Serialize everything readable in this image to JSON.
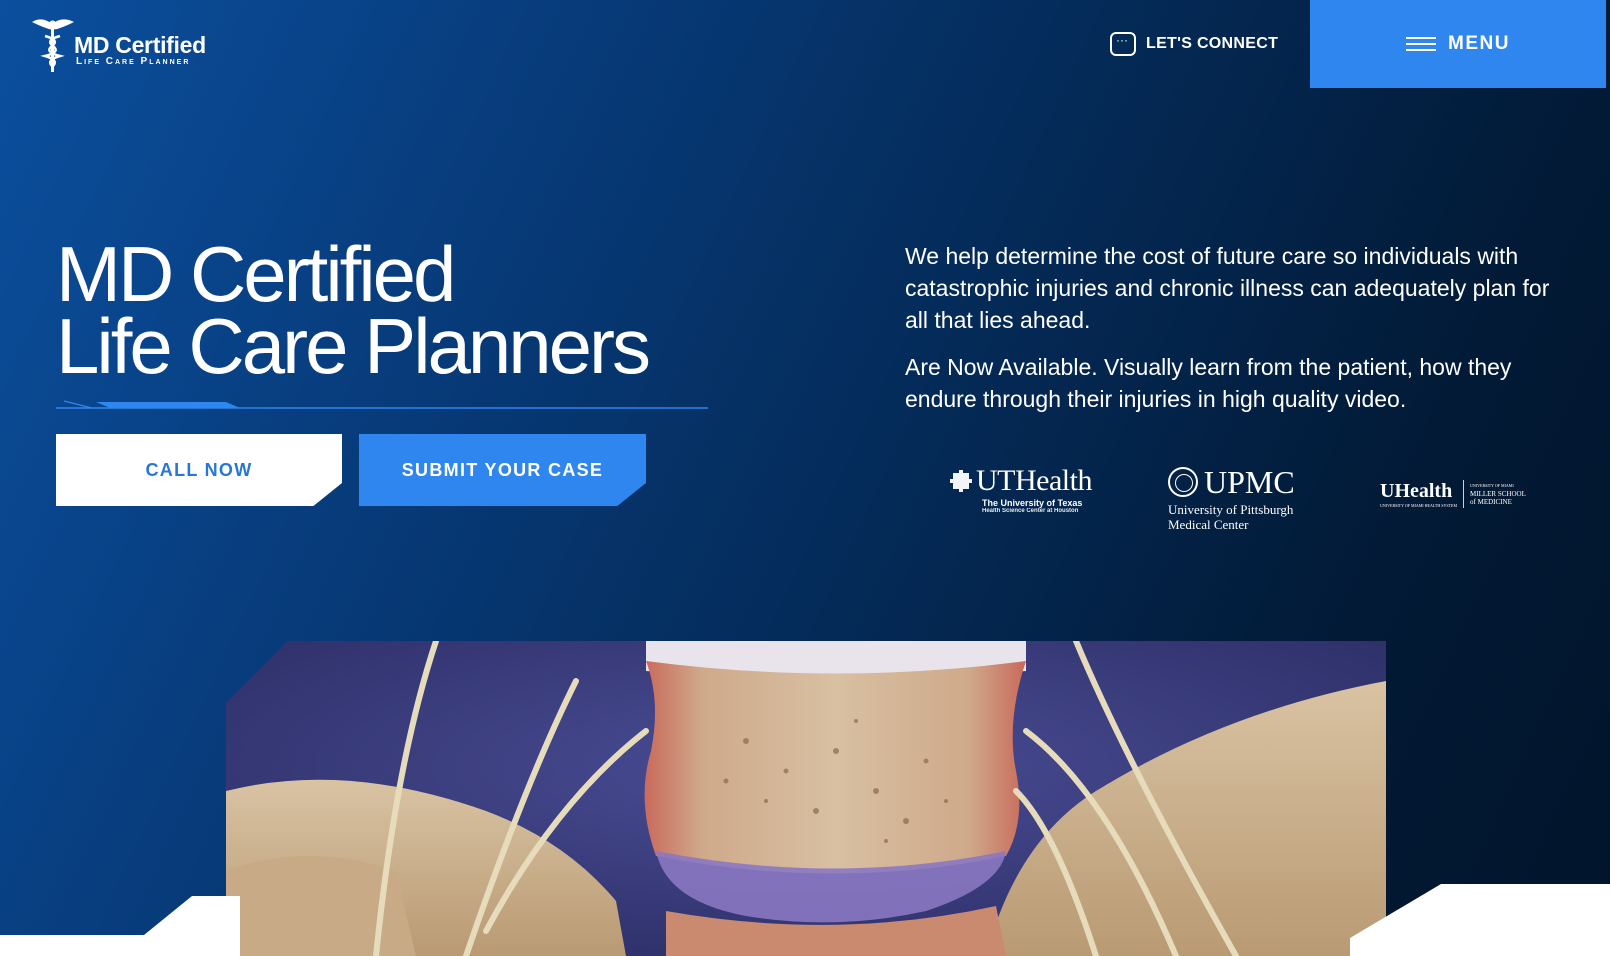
{
  "logo": {
    "name": "MD Certified",
    "subtitle": "Life Care Planner"
  },
  "header": {
    "connect_label": "LET'S CONNECT",
    "menu_label": "MENU"
  },
  "hero": {
    "title_line1": "MD Certified",
    "title_line2": "Life Care Planners",
    "call_label": "CALL NOW",
    "submit_label": "SUBMIT YOUR CASE",
    "description_1": "We help determine the cost of future care so individuals with catastrophic injuries and chronic illness can adequately plan for all that lies ahead.",
    "description_2": "Are Now Available. Visually learn from the patient, how they endure through their injuries in high quality video."
  },
  "partners": {
    "uthealth": {
      "name": "UTHealth",
      "line1": "The University of Texas",
      "line2": "Health Science Center at Houston"
    },
    "upmc": {
      "name": "UPMC",
      "line1": "University of Pittsburgh",
      "line2": "Medical Center"
    },
    "uhealth": {
      "name": "UHealth",
      "line0": "UNIVERSITY OF MIAMI HEALTH SYSTEM",
      "line1": "UNIVERSITY OF MIAMI",
      "line2": "MILLER SCHOOL",
      "line3": "of MEDICINE"
    }
  },
  "colors": {
    "accent": "#2f86ee",
    "hero_dark": "#021a36",
    "hero_light": "#0b4f9e",
    "button_text_blue": "#2777d8"
  },
  "icons": {
    "logo": "caduceus-icon",
    "connect": "chat-bubble-icon",
    "menu": "hamburger-icon"
  }
}
